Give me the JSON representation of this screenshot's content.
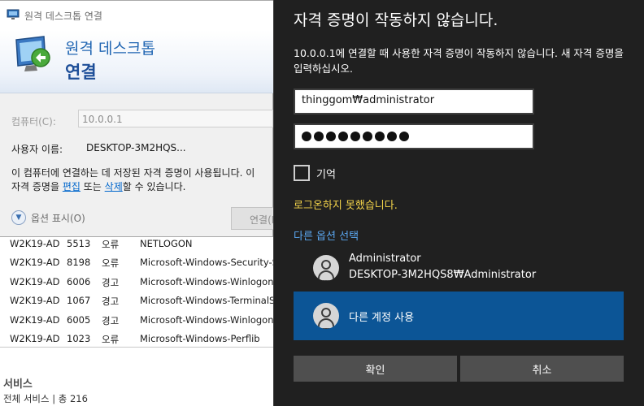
{
  "rdc": {
    "window_title": "원격 데스크톱 연결",
    "banner_line1": "원격 데스크톱",
    "banner_line2": "연결",
    "computer_label": "컴퓨터(C):",
    "computer_value": "10.0.0.1",
    "user_label": "사용자 이름:",
    "user_value": "DESKTOP-3M2HQS...",
    "cred_note_1": "이 컴퓨터에 연결하는 데 저장된 자격 증명이 사용됩니다. 이",
    "cred_note_2": "자격 증명을 ",
    "edit_link": "편집",
    "cred_note_3": " 또는 ",
    "delete_link": "삭제",
    "cred_note_4": "할 수 있습니다.",
    "options_label": "옵션 표시(O)",
    "connect_label": "연결(N)"
  },
  "events": [
    {
      "source": "W2K19-AD",
      "id": "5513",
      "level": "오류",
      "provider": "NETLOGON"
    },
    {
      "source": "W2K19-AD",
      "id": "8198",
      "level": "오류",
      "provider": "Microsoft-Windows-Security-S"
    },
    {
      "source": "W2K19-AD",
      "id": "6006",
      "level": "경고",
      "provider": "Microsoft-Windows-Winlogon"
    },
    {
      "source": "W2K19-AD",
      "id": "1067",
      "level": "경고",
      "provider": "Microsoft-Windows-TerminalS"
    },
    {
      "source": "W2K19-AD",
      "id": "6005",
      "level": "경고",
      "provider": "Microsoft-Windows-Winlogon"
    },
    {
      "source": "W2K19-AD",
      "id": "1023",
      "level": "오류",
      "provider": "Microsoft-Windows-Perflib"
    }
  ],
  "services": {
    "title": "서비스",
    "subtitle": "전체 서비스 | 총 216"
  },
  "credential": {
    "title": "자격 증명이 작동하지 않습니다.",
    "message": "10.0.0.1에 연결할 때 사용한 자격 증명이 작동하지 않습니다. 새 자격 증명을 입력하십시오.",
    "username_value": "thinggom₩administrator",
    "password_length": 9,
    "remember_label": "기억",
    "error_text": "로그온하지 못했습니다.",
    "more_options": "다른 옵션 선택",
    "account_name": "Administrator",
    "account_sub": "DESKTOP-3M2HQS8₩Administrator",
    "other_account": "다른 계정 사용",
    "ok_label": "확인",
    "cancel_label": "취소"
  },
  "colors": {
    "dialog_bg": "#202020",
    "error": "#f3d34a",
    "link": "#5aa6ef",
    "selected_account": "#0c5596",
    "button": "#4f4f4f"
  }
}
